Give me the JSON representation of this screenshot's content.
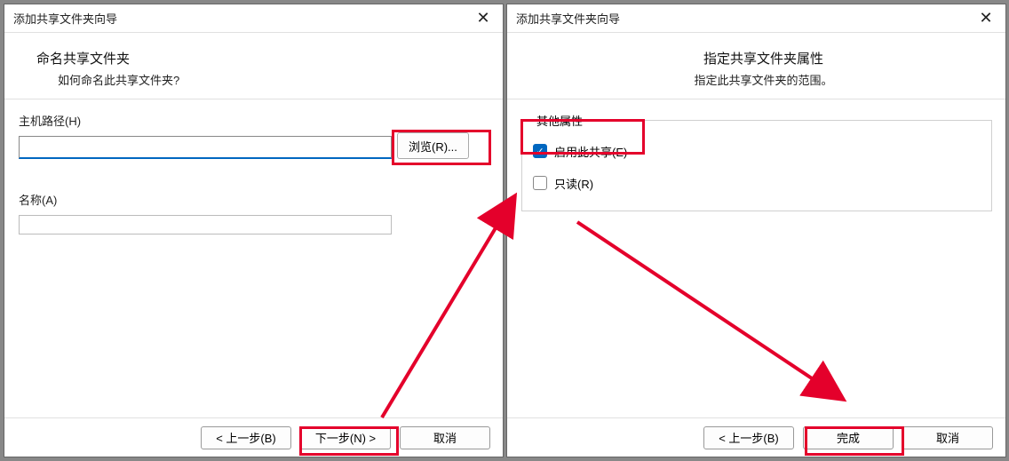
{
  "left": {
    "title": "添加共享文件夹向导",
    "heading": "命名共享文件夹",
    "subheading": "如何命名此共享文件夹?",
    "host_label": "主机路径(H)",
    "host_value": "",
    "browse_label": "浏览(R)...",
    "name_label": "名称(A)",
    "name_value": "",
    "back_label": "< 上一步(B)",
    "next_label": "下一步(N) >",
    "cancel_label": "取消"
  },
  "right": {
    "title": "添加共享文件夹向导",
    "heading": "指定共享文件夹属性",
    "subheading": "指定此共享文件夹的范围。",
    "fieldset_label": "其他属性",
    "enable_label": "启用此共享(E)",
    "enable_checked": true,
    "readonly_label": "只读(R)",
    "readonly_checked": false,
    "back_label": "< 上一步(B)",
    "finish_label": "完成",
    "cancel_label": "取消"
  }
}
